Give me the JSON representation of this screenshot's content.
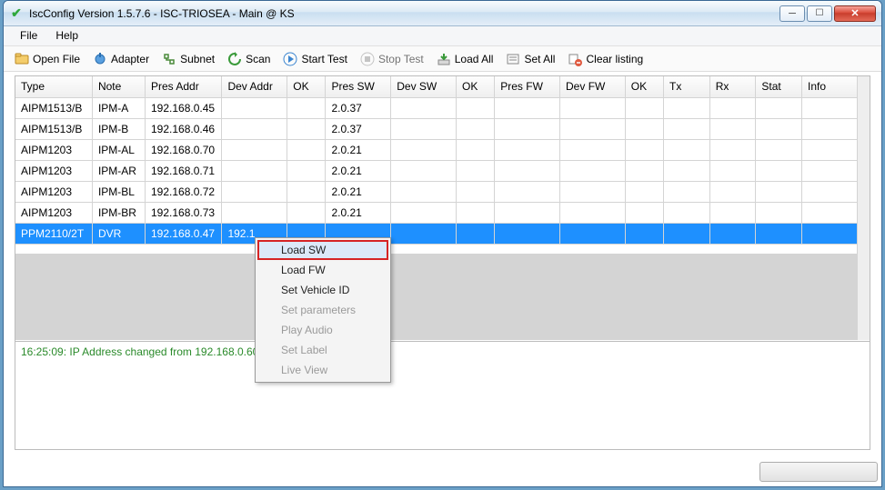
{
  "window": {
    "title": "IscConfig Version 1.5.7.6 - ISC-TRIOSEA - Main @ KS"
  },
  "menu": {
    "file": "File",
    "help": "Help"
  },
  "toolbar": {
    "open_file": "Open File",
    "adapter": "Adapter",
    "subnet": "Subnet",
    "scan": "Scan",
    "start_test": "Start Test",
    "stop_test": "Stop Test",
    "load_all": "Load All",
    "set_all": "Set All",
    "clear_listing": "Clear listing"
  },
  "columns": {
    "type": "Type",
    "note": "Note",
    "pres_addr": "Pres Addr",
    "dev_addr": "Dev Addr",
    "ok1": "OK",
    "pres_sw": "Pres SW",
    "dev_sw": "Dev SW",
    "ok2": "OK",
    "pres_fw": "Pres FW",
    "dev_fw": "Dev FW",
    "ok3": "OK",
    "tx": "Tx",
    "rx": "Rx",
    "stat": "Stat",
    "info": "Info"
  },
  "rows": [
    {
      "type": "AIPM1513/B",
      "note": "IPM-A",
      "pres_addr": "192.168.0.45",
      "dev_addr": "",
      "ok1": "",
      "pres_sw": "2.0.37",
      "dev_sw": "",
      "ok2": "",
      "pres_fw": "",
      "dev_fw": "",
      "ok3": "",
      "tx": "",
      "rx": "",
      "stat": "",
      "info": ""
    },
    {
      "type": "AIPM1513/B",
      "note": "IPM-B",
      "pres_addr": "192.168.0.46",
      "dev_addr": "",
      "ok1": "",
      "pres_sw": "2.0.37",
      "dev_sw": "",
      "ok2": "",
      "pres_fw": "",
      "dev_fw": "",
      "ok3": "",
      "tx": "",
      "rx": "",
      "stat": "",
      "info": ""
    },
    {
      "type": "AIPM1203",
      "note": "IPM-AL",
      "pres_addr": "192.168.0.70",
      "dev_addr": "",
      "ok1": "",
      "pres_sw": "2.0.21",
      "dev_sw": "",
      "ok2": "",
      "pres_fw": "",
      "dev_fw": "",
      "ok3": "",
      "tx": "",
      "rx": "",
      "stat": "",
      "info": ""
    },
    {
      "type": "AIPM1203",
      "note": "IPM-AR",
      "pres_addr": "192.168.0.71",
      "dev_addr": "",
      "ok1": "",
      "pres_sw": "2.0.21",
      "dev_sw": "",
      "ok2": "",
      "pres_fw": "",
      "dev_fw": "",
      "ok3": "",
      "tx": "",
      "rx": "",
      "stat": "",
      "info": ""
    },
    {
      "type": "AIPM1203",
      "note": "IPM-BL",
      "pres_addr": "192.168.0.72",
      "dev_addr": "",
      "ok1": "",
      "pres_sw": "2.0.21",
      "dev_sw": "",
      "ok2": "",
      "pres_fw": "",
      "dev_fw": "",
      "ok3": "",
      "tx": "",
      "rx": "",
      "stat": "",
      "info": ""
    },
    {
      "type": "AIPM1203",
      "note": "IPM-BR",
      "pres_addr": "192.168.0.73",
      "dev_addr": "",
      "ok1": "",
      "pres_sw": "2.0.21",
      "dev_sw": "",
      "ok2": "",
      "pres_fw": "",
      "dev_fw": "",
      "ok3": "",
      "tx": "",
      "rx": "",
      "stat": "",
      "info": ""
    },
    {
      "type": "PPM2110/2T",
      "note": "DVR",
      "pres_addr": "192.168.0.47",
      "dev_addr": "192.1",
      "ok1": "",
      "pres_sw": "",
      "dev_sw": "",
      "ok2": "",
      "pres_fw": "",
      "dev_fw": "",
      "ok3": "",
      "tx": "",
      "rx": "",
      "stat": "",
      "info": "",
      "selected": true
    }
  ],
  "context_menu": {
    "load_sw": "Load SW",
    "load_fw": "Load FW",
    "set_vehicle_id": "Set Vehicle ID",
    "set_parameters": "Set parameters",
    "play_audio": "Play Audio",
    "set_label": "Set Label",
    "live_view": "Live View"
  },
  "log": {
    "line1": "16:25:09: IP Address changed from 192.168.0.60"
  },
  "colors": {
    "selection": "#1e90ff",
    "highlight_border": "#d62424",
    "log_text": "#2a8a2a"
  }
}
